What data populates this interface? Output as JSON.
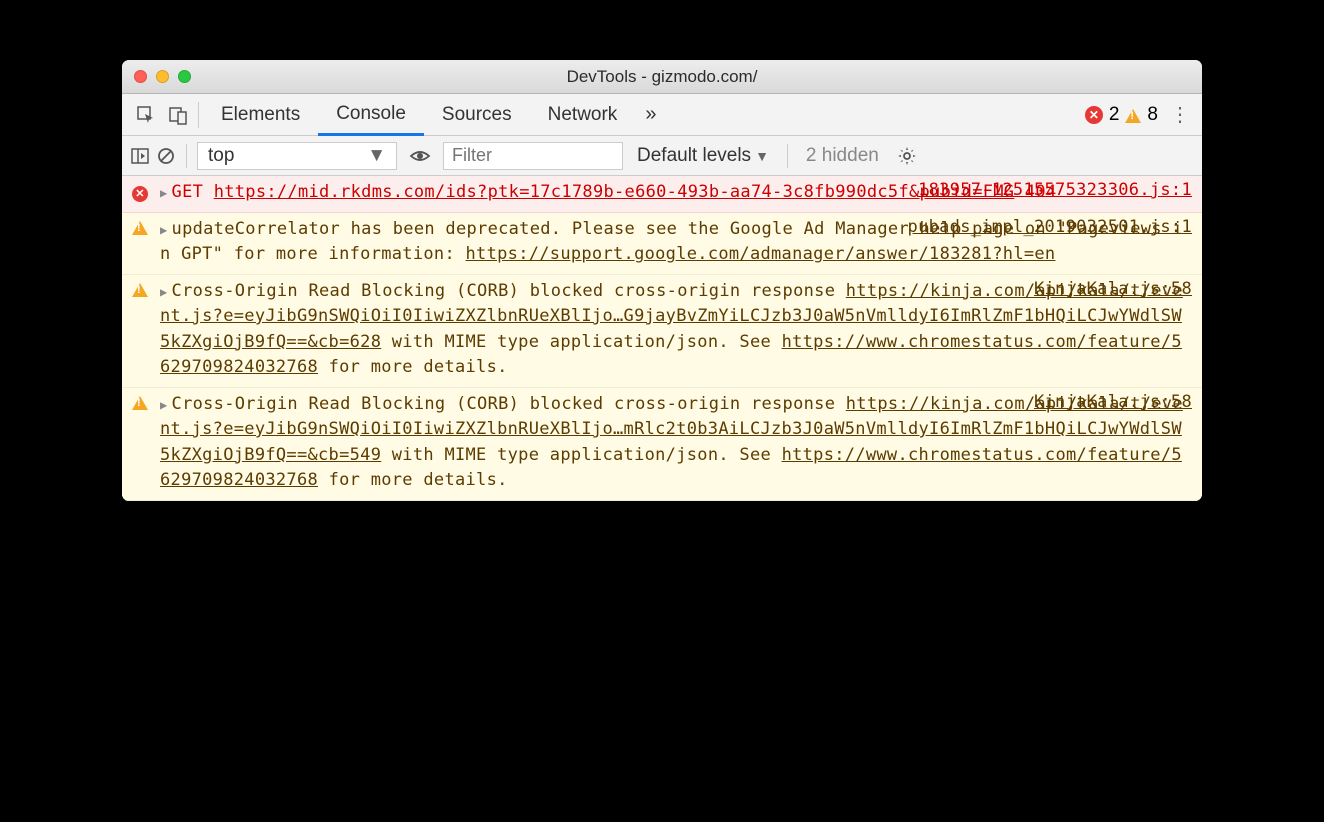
{
  "window": {
    "title": "DevTools - gizmodo.com/"
  },
  "tabs": {
    "items": [
      "Elements",
      "Console",
      "Sources",
      "Network"
    ],
    "active": "Console",
    "overflow": "»"
  },
  "status": {
    "errors": "2",
    "warnings": "8"
  },
  "toolbar": {
    "context": "top",
    "filter_placeholder": "Filter",
    "levels_label": "Default levels",
    "hidden_label": "2 hidden"
  },
  "messages": [
    {
      "type": "error",
      "method": "GET",
      "url": "https://mid.rkdms.com/ids?ptk=17c1789b-e660-493b-aa74-3c8fb990dc5f&pubid=FMG",
      "code": "404",
      "source": "183957-12515575323306.js:1"
    },
    {
      "type": "warning",
      "text_a": "updateCorrelator has been deprecated. Please see the Google Ad Manager help page on \"Pageviews in GPT\" for more information: ",
      "link_a": "https://support.google.com/admanager/answer/183281?hl=en",
      "source": "pubads_impl_2019032501.js:1"
    },
    {
      "type": "warning",
      "text_a": "Cross-Origin Read Blocking (CORB) blocked cross-origin response ",
      "link_a": "https://kinja.com/api/kala/t/event.js?e=eyJibG9nSWQiOiI0IiwiZXZlbnRUeXBlIjo…G9jayBvZmYiLCJzb3J0aW5nVmlldyI6ImRlZmF1bHQiLCJwYWdlSW5kZXgiOjB9fQ==&cb=628",
      "text_b": " with MIME type application/json. See ",
      "link_b": "https://www.chromestatus.com/feature/5629709824032768",
      "text_c": " for more details.",
      "source": "KinjaKala.js:58"
    },
    {
      "type": "warning",
      "text_a": "Cross-Origin Read Blocking (CORB) blocked cross-origin response ",
      "link_a": "https://kinja.com/api/kala/t/event.js?e=eyJibG9nSWQiOiI0IiwiZXZlbnRUeXBlIjo…mRlc2t0b3AiLCJzb3J0aW5nVmlldyI6ImRlZmF1bHQiLCJwYWdlSW5kZXgiOjB9fQ==&cb=549",
      "text_b": " with MIME type application/json. See ",
      "link_b": "https://www.chromestatus.com/feature/5629709824032768",
      "text_c": " for more details.",
      "source": "KinjaKala.js:58"
    }
  ]
}
